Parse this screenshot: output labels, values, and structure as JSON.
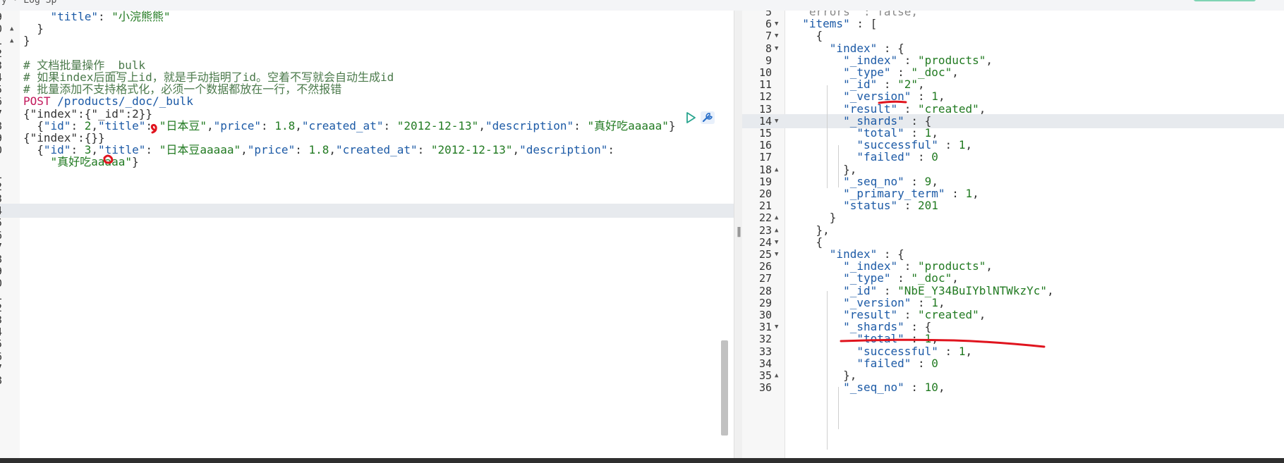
{
  "top_bar": {
    "tab_text": "y  ·  Log    Sp"
  },
  "request_lines": [
    {
      "n": "9",
      "fold": "",
      "tokens": [
        [
          "    ",
          "c-punc"
        ],
        [
          "\"title\"",
          "c-key"
        ],
        [
          ": ",
          "c-punc"
        ],
        [
          "\"小浣熊熊\"",
          "c-str"
        ]
      ]
    },
    {
      "n": "0",
      "fold": "▲",
      "tokens": [
        [
          "  }",
          "c-punc"
        ]
      ]
    },
    {
      "n": "1",
      "fold": "▲",
      "tokens": [
        [
          "}",
          "c-punc"
        ]
      ]
    },
    {
      "n": "2",
      "fold": "",
      "tokens": []
    },
    {
      "n": "3",
      "fold": "",
      "tokens": [
        [
          "# 文档批量操作 _bulk",
          "c-com"
        ]
      ]
    },
    {
      "n": "4",
      "fold": "",
      "tokens": [
        [
          "# 如果index后面写上id，就是手动指明了id。空着不写就会自动生成id",
          "c-com"
        ]
      ]
    },
    {
      "n": "5",
      "fold": "",
      "tokens": [
        [
          "# 批量添加不支持格式化，必须一个数据都放在一行，不然报错",
          "c-com"
        ]
      ]
    },
    {
      "n": "6",
      "fold": "",
      "tokens": [
        [
          "POST",
          "c-kw"
        ],
        [
          " /products/_doc/_bulk",
          "c-path"
        ]
      ]
    },
    {
      "n": "7",
      "fold": "",
      "tokens": [
        [
          "{\"index\":{\"_id\":2}}",
          "c-punc"
        ]
      ]
    },
    {
      "n": "8",
      "fold": "",
      "tokens": [
        [
          "  {",
          "c-punc"
        ],
        [
          "\"id\"",
          "c-key"
        ],
        [
          ": ",
          "c-punc"
        ],
        [
          "2",
          "c-num"
        ],
        [
          ",",
          "c-punc"
        ],
        [
          "\"title\"",
          "c-key"
        ],
        [
          ": ",
          "c-punc"
        ],
        [
          "\"日本豆\"",
          "c-str"
        ],
        [
          ",",
          "c-punc"
        ],
        [
          "\"price\"",
          "c-key"
        ],
        [
          ": ",
          "c-punc"
        ],
        [
          "1.8",
          "c-num"
        ],
        [
          ",",
          "c-punc"
        ],
        [
          "\"created_at\"",
          "c-key"
        ],
        [
          ": ",
          "c-punc"
        ],
        [
          "\"2012-12-13\"",
          "c-str"
        ],
        [
          ",",
          "c-punc"
        ],
        [
          "\"description\"",
          "c-key"
        ],
        [
          ": ",
          "c-punc"
        ],
        [
          "\"真好吃aaaaa\"",
          "c-str"
        ],
        [
          "}",
          "c-punc"
        ]
      ]
    },
    {
      "n": "9",
      "fold": "",
      "tokens": [
        [
          "{\"index\":{}}",
          "c-punc"
        ]
      ]
    },
    {
      "n": "0",
      "fold": "",
      "tokens": [
        [
          "  {",
          "c-punc"
        ],
        [
          "\"id\"",
          "c-key"
        ],
        [
          ": ",
          "c-punc"
        ],
        [
          "3",
          "c-num"
        ],
        [
          ",",
          "c-punc"
        ],
        [
          "\"title\"",
          "c-key"
        ],
        [
          ": ",
          "c-punc"
        ],
        [
          "\"日本豆aaaaa\"",
          "c-str"
        ],
        [
          ",",
          "c-punc"
        ],
        [
          "\"price\"",
          "c-key"
        ],
        [
          ": ",
          "c-punc"
        ],
        [
          "1.8",
          "c-num"
        ],
        [
          ",",
          "c-punc"
        ],
        [
          "\"created_at\"",
          "c-key"
        ],
        [
          ": ",
          "c-punc"
        ],
        [
          "\"2012-12-13\"",
          "c-str"
        ],
        [
          ",",
          "c-punc"
        ],
        [
          "\"description\"",
          "c-key"
        ],
        [
          ":",
          "c-punc"
        ]
      ]
    },
    {
      "n": "",
      "fold": "",
      "tokens": [
        [
          "    ",
          "c-punc"
        ],
        [
          "\"真好吃aaaaa\"",
          "c-str"
        ],
        [
          "}",
          "c-punc"
        ]
      ]
    },
    {
      "n": "1",
      "fold": "",
      "tokens": []
    },
    {
      "n": "2",
      "fold": "",
      "tokens": []
    },
    {
      "n": "3",
      "fold": "",
      "tokens": []
    },
    {
      "n": "4",
      "fold": "",
      "tokens": [],
      "active": true
    },
    {
      "n": "5",
      "fold": "",
      "tokens": []
    },
    {
      "n": "6",
      "fold": "",
      "tokens": []
    },
    {
      "n": "7",
      "fold": "",
      "tokens": []
    },
    {
      "n": "8",
      "fold": "",
      "tokens": []
    },
    {
      "n": "9",
      "fold": "",
      "tokens": []
    },
    {
      "n": "0",
      "fold": "",
      "tokens": []
    },
    {
      "n": "1",
      "fold": "",
      "tokens": []
    },
    {
      "n": "2",
      "fold": "",
      "tokens": []
    },
    {
      "n": "3",
      "fold": "",
      "tokens": []
    },
    {
      "n": "4",
      "fold": "",
      "tokens": []
    },
    {
      "n": "5",
      "fold": "",
      "tokens": []
    },
    {
      "n": "6",
      "fold": "",
      "tokens": []
    },
    {
      "n": "7",
      "fold": "",
      "tokens": []
    },
    {
      "n": "8",
      "fold": "",
      "tokens": []
    }
  ],
  "response_lines": [
    {
      "n": "5",
      "fold": "",
      "tokens": [
        [
          "  \"errors\"",
          "c-grey"
        ],
        [
          " : ",
          "c-grey"
        ],
        [
          "false",
          "c-grey"
        ],
        [
          ",",
          "c-grey"
        ]
      ]
    },
    {
      "n": "6",
      "fold": "▼",
      "tokens": [
        [
          "  \"items\"",
          "c-key"
        ],
        [
          " : [",
          "c-punc"
        ]
      ]
    },
    {
      "n": "7",
      "fold": "▼",
      "tokens": [
        [
          "    {",
          "c-punc"
        ]
      ]
    },
    {
      "n": "8",
      "fold": "▼",
      "tokens": [
        [
          "      \"index\"",
          "c-key"
        ],
        [
          " : {",
          "c-punc"
        ]
      ]
    },
    {
      "n": "9",
      "fold": "",
      "tokens": [
        [
          "        \"_index\"",
          "c-key"
        ],
        [
          " : ",
          "c-punc"
        ],
        [
          "\"products\"",
          "c-str"
        ],
        [
          ",",
          "c-punc"
        ]
      ]
    },
    {
      "n": "10",
      "fold": "",
      "tokens": [
        [
          "        \"_type\"",
          "c-key"
        ],
        [
          " : ",
          "c-punc"
        ],
        [
          "\"_doc\"",
          "c-str"
        ],
        [
          ",",
          "c-punc"
        ]
      ]
    },
    {
      "n": "11",
      "fold": "",
      "tokens": [
        [
          "        \"_id\"",
          "c-key"
        ],
        [
          " : ",
          "c-punc"
        ],
        [
          "\"2\"",
          "c-str"
        ],
        [
          ",",
          "c-punc"
        ]
      ]
    },
    {
      "n": "12",
      "fold": "",
      "tokens": [
        [
          "        \"_version\"",
          "c-key"
        ],
        [
          " : ",
          "c-punc"
        ],
        [
          "1",
          "c-num"
        ],
        [
          ",",
          "c-punc"
        ]
      ]
    },
    {
      "n": "13",
      "fold": "",
      "tokens": [
        [
          "        \"result\"",
          "c-key"
        ],
        [
          " : ",
          "c-punc"
        ],
        [
          "\"created\"",
          "c-str"
        ],
        [
          ",",
          "c-punc"
        ]
      ]
    },
    {
      "n": "14",
      "fold": "▼",
      "tokens": [
        [
          "        \"_shards\"",
          "c-key"
        ],
        [
          " : {",
          "c-punc"
        ]
      ],
      "active": true
    },
    {
      "n": "15",
      "fold": "",
      "tokens": [
        [
          "          \"total\"",
          "c-key"
        ],
        [
          " : ",
          "c-punc"
        ],
        [
          "1",
          "c-num"
        ],
        [
          ",",
          "c-punc"
        ]
      ]
    },
    {
      "n": "16",
      "fold": "",
      "tokens": [
        [
          "          \"successful\"",
          "c-key"
        ],
        [
          " : ",
          "c-punc"
        ],
        [
          "1",
          "c-num"
        ],
        [
          ",",
          "c-punc"
        ]
      ]
    },
    {
      "n": "17",
      "fold": "",
      "tokens": [
        [
          "          \"failed\"",
          "c-key"
        ],
        [
          " : ",
          "c-punc"
        ],
        [
          "0",
          "c-num"
        ]
      ]
    },
    {
      "n": "18",
      "fold": "▲",
      "tokens": [
        [
          "        },",
          "c-punc"
        ]
      ]
    },
    {
      "n": "19",
      "fold": "",
      "tokens": [
        [
          "        \"_seq_no\"",
          "c-key"
        ],
        [
          " : ",
          "c-punc"
        ],
        [
          "9",
          "c-num"
        ],
        [
          ",",
          "c-punc"
        ]
      ]
    },
    {
      "n": "20",
      "fold": "",
      "tokens": [
        [
          "        \"_primary_term\"",
          "c-key"
        ],
        [
          " : ",
          "c-punc"
        ],
        [
          "1",
          "c-num"
        ],
        [
          ",",
          "c-punc"
        ]
      ]
    },
    {
      "n": "21",
      "fold": "",
      "tokens": [
        [
          "        \"status\"",
          "c-key"
        ],
        [
          " : ",
          "c-punc"
        ],
        [
          "201",
          "c-num"
        ]
      ]
    },
    {
      "n": "22",
      "fold": "▲",
      "tokens": [
        [
          "      }",
          "c-punc"
        ]
      ]
    },
    {
      "n": "23",
      "fold": "▲",
      "tokens": [
        [
          "    },",
          "c-punc"
        ]
      ]
    },
    {
      "n": "24",
      "fold": "▼",
      "tokens": [
        [
          "    {",
          "c-punc"
        ]
      ]
    },
    {
      "n": "25",
      "fold": "▼",
      "tokens": [
        [
          "      \"index\"",
          "c-key"
        ],
        [
          " : {",
          "c-punc"
        ]
      ]
    },
    {
      "n": "26",
      "fold": "",
      "tokens": [
        [
          "        \"_index\"",
          "c-key"
        ],
        [
          " : ",
          "c-punc"
        ],
        [
          "\"products\"",
          "c-str"
        ],
        [
          ",",
          "c-punc"
        ]
      ]
    },
    {
      "n": "27",
      "fold": "",
      "tokens": [
        [
          "        \"_type\"",
          "c-key"
        ],
        [
          " : ",
          "c-punc"
        ],
        [
          "\"_doc\"",
          "c-str"
        ],
        [
          ",",
          "c-punc"
        ]
      ]
    },
    {
      "n": "28",
      "fold": "",
      "tokens": [
        [
          "        \"_id\"",
          "c-key"
        ],
        [
          " : ",
          "c-punc"
        ],
        [
          "\"NbE_Y34BuIYblNTWkzYc\"",
          "c-str"
        ],
        [
          ",",
          "c-punc"
        ]
      ]
    },
    {
      "n": "29",
      "fold": "",
      "tokens": [
        [
          "        \"_version\"",
          "c-key"
        ],
        [
          " : ",
          "c-punc"
        ],
        [
          "1",
          "c-num"
        ],
        [
          ",",
          "c-punc"
        ]
      ]
    },
    {
      "n": "30",
      "fold": "",
      "tokens": [
        [
          "        \"result\"",
          "c-key"
        ],
        [
          " : ",
          "c-punc"
        ],
        [
          "\"created\"",
          "c-str"
        ],
        [
          ",",
          "c-punc"
        ]
      ]
    },
    {
      "n": "31",
      "fold": "▼",
      "tokens": [
        [
          "        \"_shards\"",
          "c-key"
        ],
        [
          " : {",
          "c-punc"
        ]
      ]
    },
    {
      "n": "32",
      "fold": "",
      "tokens": [
        [
          "          \"total\"",
          "c-key"
        ],
        [
          " : ",
          "c-punc"
        ],
        [
          "1",
          "c-num"
        ],
        [
          ",",
          "c-punc"
        ]
      ]
    },
    {
      "n": "33",
      "fold": "",
      "tokens": [
        [
          "          \"successful\"",
          "c-key"
        ],
        [
          " : ",
          "c-punc"
        ],
        [
          "1",
          "c-num"
        ],
        [
          ",",
          "c-punc"
        ]
      ]
    },
    {
      "n": "34",
      "fold": "",
      "tokens": [
        [
          "          \"failed\"",
          "c-key"
        ],
        [
          " : ",
          "c-punc"
        ],
        [
          "0",
          "c-num"
        ]
      ]
    },
    {
      "n": "35",
      "fold": "▲",
      "tokens": [
        [
          "        },",
          "c-punc"
        ]
      ]
    },
    {
      "n": "36",
      "fold": "",
      "tokens": [
        [
          "        \"_seq_no\"",
          "c-key"
        ],
        [
          " : ",
          "c-punc"
        ],
        [
          "10",
          "c-num"
        ],
        [
          ",",
          "c-punc"
        ]
      ]
    }
  ],
  "colors": {
    "annotation_red": "#e0141e",
    "keyword": "#c2185b",
    "key": "#1c5aa6",
    "string": "#217a21"
  }
}
